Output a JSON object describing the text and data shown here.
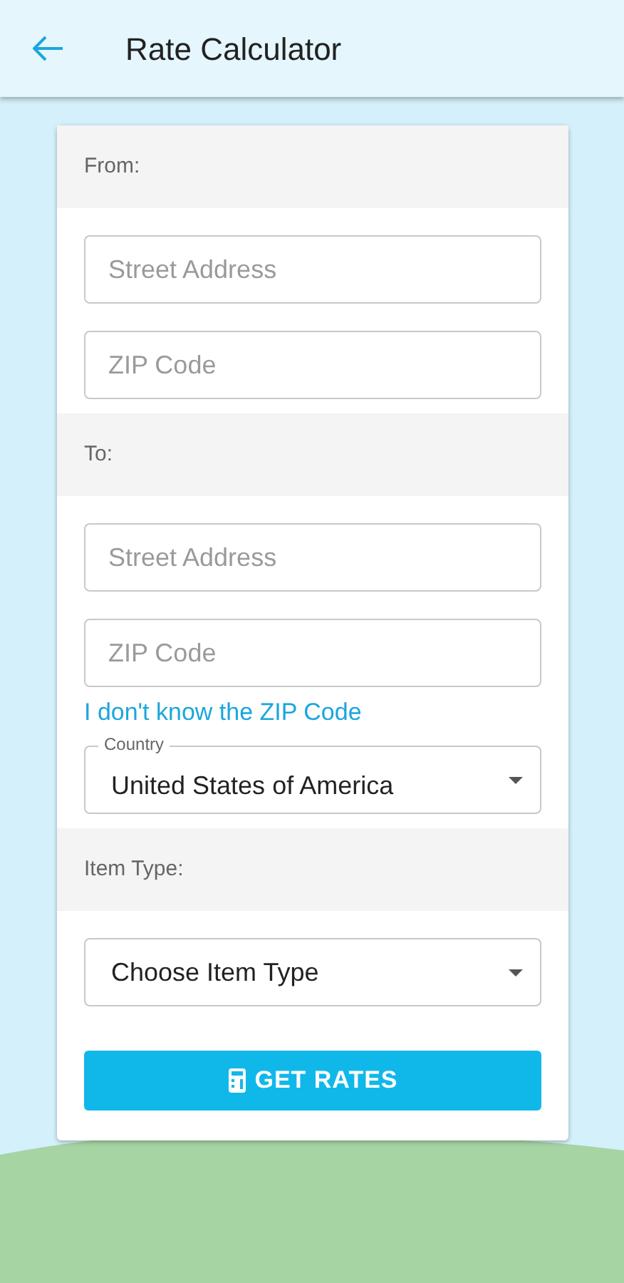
{
  "app_bar": {
    "title": "Rate Calculator"
  },
  "sections": [
    {
      "label": "From:",
      "items": [
        {
          "kind": "input",
          "placeholder": "Street Address"
        },
        {
          "kind": "input",
          "placeholder": "ZIP Code"
        }
      ]
    },
    {
      "label": "To:",
      "items": [
        {
          "kind": "input",
          "placeholder": "Street Address"
        },
        {
          "kind": "input",
          "placeholder": "ZIP Code"
        },
        {
          "kind": "link",
          "text": "I don't know the ZIP Code"
        },
        {
          "kind": "select",
          "label": "Country",
          "value": "United States of America"
        }
      ]
    },
    {
      "label": "Item Type:",
      "items": [
        {
          "kind": "select",
          "value": "Choose Item Type"
        }
      ]
    }
  ],
  "button": {
    "label": "GET RATES"
  }
}
